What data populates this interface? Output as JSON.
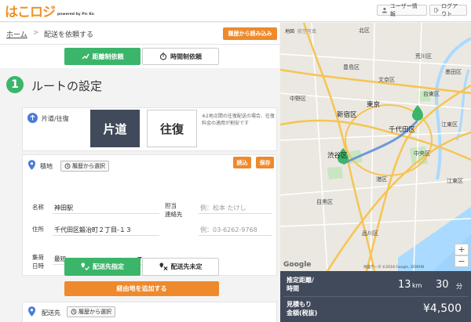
{
  "header": {
    "logo_text": "はこロジ",
    "logo_sub": "powered by Pic Ko",
    "user_info_label": "ユーザー情報",
    "logout_label": "ログアウト"
  },
  "breadcrumb": {
    "home": "ホーム",
    "separator": ">",
    "current": "配送を依頼する",
    "history_button": "履歴から読み込み"
  },
  "mode": {
    "distance_label": "距離制依頼",
    "time_label": "時間制依頼"
  },
  "step": {
    "number": "1",
    "title": "ルートの設定"
  },
  "trip": {
    "label": "片道/往復",
    "oneway_label": "片道",
    "roundtrip_label": "往復",
    "note": "※2地点間の往復配送の場合、往復料金の適用が割安です"
  },
  "pickup": {
    "label": "積地",
    "history_button": "履歴から選択",
    "load_button": "読込",
    "save_button": "保存",
    "name_label": "名称",
    "name_value": "神田駅",
    "contact_label_1": "担当",
    "contact_label_2": "連絡先",
    "contact_name_placeholder": "例：松本 たけし",
    "contact_phone_placeholder": "例：03-6262-9768",
    "address_label": "住所",
    "address_value": "千代田区鍛冶町２丁目-１３",
    "pickup_time_label_1": "集荷",
    "pickup_time_label_2": "日時",
    "pickup_time_value": "最短"
  },
  "destination": {
    "specified_label": "配送先指定",
    "unspecified_label": "配送先未定",
    "add_via_label": "経由地を追加する",
    "label": "配送先",
    "history_button": "履歴から選択"
  },
  "map": {
    "tab_map": "地図",
    "tab_satellite": "航空写真",
    "labels": {
      "kita": "北区",
      "arakawa": "荒川区",
      "sumida": "墨田区",
      "toshima": "豊島区",
      "bunkyo": "文京区",
      "taito": "台東区",
      "nakano": "中野区",
      "tokyo": "東京",
      "shinjuku": "新宿区",
      "chiyoda": "千代田区",
      "koto": "江東区",
      "shibuya": "渋谷区",
      "chuo": "中央区",
      "minato": "港区",
      "koto_east": "江東区",
      "meguro": "目黒区",
      "shinagawa": "品川区"
    },
    "zoom_in": "+",
    "zoom_out": "−",
    "google": "Google",
    "copyright": "地図データ ©2018 Google, ZENRIN"
  },
  "summary": {
    "distance_label_1": "推定距離/",
    "distance_label_2": "時間",
    "distance_value": "13",
    "distance_unit": "km",
    "time_value": "30",
    "time_unit": "分",
    "price_label_1": "見積もり",
    "price_label_2": "金額(税抜)",
    "price_value": "¥4,500"
  },
  "colors": {
    "accent_green": "#3bb56a",
    "accent_orange": "#ee8a2c",
    "summary_bg": "#414a5a",
    "pin_blue": "#4a7bd6"
  }
}
